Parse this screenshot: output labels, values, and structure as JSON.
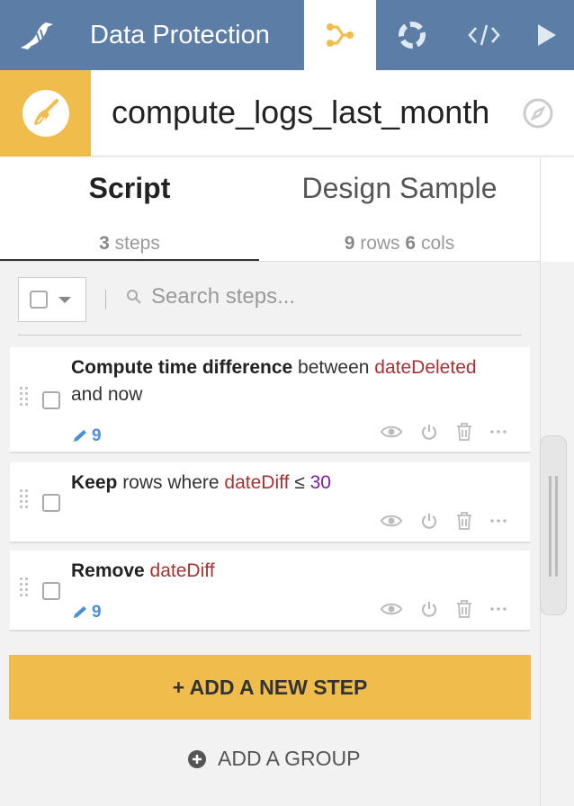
{
  "topnav": {
    "project_name": "Data Protection",
    "colors": {
      "background": "#5c7da6",
      "active_tab": "#ffffff",
      "flow_icon": "#f0bd4c"
    }
  },
  "recipe": {
    "name": "compute_logs_last_month",
    "color": "#f0bd4c"
  },
  "tabs": {
    "script": {
      "label": "Script",
      "count": "3",
      "unit": "steps"
    },
    "sample": {
      "label": "Design Sample",
      "rows": "9",
      "rows_unit": "rows",
      "cols": "6",
      "cols_unit": "cols"
    }
  },
  "search": {
    "placeholder": "Search steps..."
  },
  "steps": [
    {
      "bold": "Compute time difference",
      "text1": " between ",
      "column": "dateDeleted",
      "text2": " and now",
      "edit_count": "9"
    },
    {
      "bold": "Keep",
      "text1": " rows where ",
      "column": "dateDiff",
      "operator": " ≤ ",
      "value": "30"
    },
    {
      "bold": "Remove",
      "text1": " ",
      "column": "dateDiff",
      "edit_count": "9"
    }
  ],
  "buttons": {
    "add_step": "+ ADD A NEW STEP",
    "add_group": "ADD A GROUP"
  }
}
